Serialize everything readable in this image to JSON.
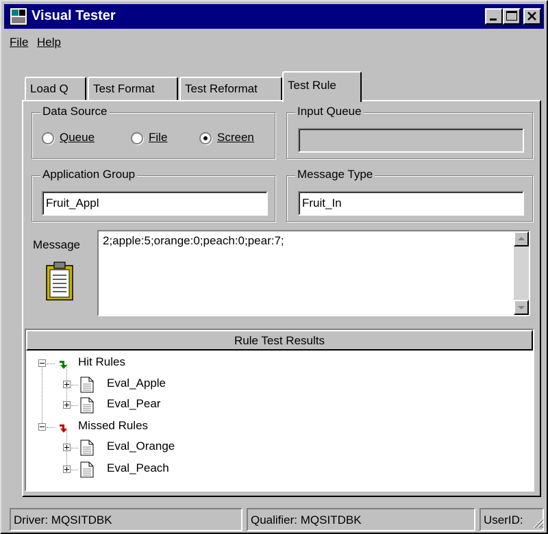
{
  "window": {
    "title": "Visual Tester"
  },
  "menu": {
    "file": "File",
    "help": "Help"
  },
  "tabs": [
    {
      "label": "Load Q"
    },
    {
      "label": "Test Format"
    },
    {
      "label": "Test Reformat"
    },
    {
      "label": "Test Rule",
      "active": true
    }
  ],
  "data_source": {
    "legend": "Data Source",
    "options": [
      "Queue",
      "File",
      "Screen"
    ],
    "selected": "Screen"
  },
  "input_queue": {
    "legend": "Input Queue",
    "value": ""
  },
  "application_group": {
    "legend": "Application Group",
    "value": "Fruit_Appl"
  },
  "message_type": {
    "legend": "Message Type",
    "value": "Fruit_In"
  },
  "message": {
    "label": "Message",
    "value": "2;apple:5;orange:0;peach:0;pear:7;",
    "icon": "clipboard-icon"
  },
  "results": {
    "header": "Rule Test Results",
    "hit": {
      "label": "Hit Rules",
      "icon": "green-arrow-icon",
      "items": [
        "Eval_Apple",
        "Eval_Pear"
      ]
    },
    "missed": {
      "label": "Missed Rules",
      "icon": "red-arrow-icon",
      "items": [
        "Eval_Orange",
        "Eval_Peach"
      ]
    }
  },
  "status": {
    "driver": "Driver:  MQSITDBK",
    "qualifier": "Qualifier:  MQSITDBK",
    "userid": "UserID:"
  },
  "colors": {
    "titlebar": "#000080",
    "face": "#c0c0c0",
    "hit_arrow": "#008000",
    "miss_arrow": "#c00000"
  }
}
